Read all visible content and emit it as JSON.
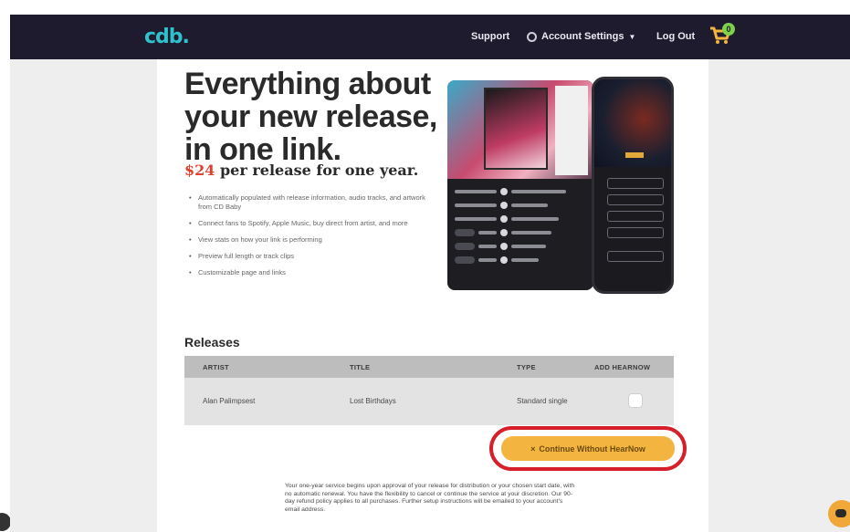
{
  "header": {
    "logo_text": "cdb.",
    "nav": {
      "support": "Support",
      "account_settings": "Account Settings",
      "log_out": "Log Out"
    },
    "cart_count": "0",
    "colors": {
      "bar": "#1f1b2e",
      "logo": "#2fc1cc",
      "cart": "#f3b53f"
    }
  },
  "hero": {
    "title": "Everything about your new release, in one link.",
    "price_amount": "$24",
    "price_rest": " per release for one year.",
    "features": [
      "Automatically populated with release information, audio tracks, and artwork from CD Baby",
      "Connect fans to Spotify, Apple Music, buy direct from artist, and more",
      "View stats on how your link is performing",
      "Preview full length or track clips",
      "Customizable page and links"
    ]
  },
  "releases": {
    "title": "Releases",
    "columns": [
      "ARTIST",
      "TITLE",
      "TYPE",
      "ADD HEARNOW"
    ],
    "rows": [
      {
        "artist": "Alan Palimpsest",
        "title": "Lost Birthdays",
        "type": "Standard single",
        "add_hearnow": false
      }
    ]
  },
  "actions": {
    "continue_label": "Continue Without HearNow",
    "continue_icon": "close-icon",
    "accent": "#f3b53f",
    "highlight_color": "#d61f2a"
  },
  "disclaimer": "Your one-year service begins upon approval of your release for distribution or your chosen start date, with no automatic renewal. You have the flexibility to cancel or continue the service at your discretion. Our 90-day refund policy applies to all purchases. Further setup instructions will be emailed to your account's email address."
}
